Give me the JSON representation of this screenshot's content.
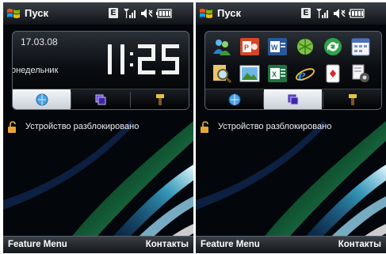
{
  "title_bar": {
    "start_label": "Пуск",
    "network_badge": "E"
  },
  "home": {
    "date": "17.03.08",
    "weekday": "понедельник",
    "time": "11:25"
  },
  "lock_status": "Устройство разблокировано",
  "softkeys": {
    "left": "Feature Menu",
    "right": "Контакты"
  },
  "program_icons": [
    "contacts-icon",
    "powerpoint-icon",
    "word-icon",
    "solitaire-leaf-icon",
    "sync-icon",
    "calendar-icon",
    "search-icon",
    "pictures-icon",
    "excel-icon",
    "internet-explorer-icon",
    "cards-game-icon",
    "settings-icon"
  ],
  "colors": {
    "panel_border": "#5f6671",
    "active_tab": "#eef1f4",
    "wallpaper_streak": "#3fb7e0"
  }
}
